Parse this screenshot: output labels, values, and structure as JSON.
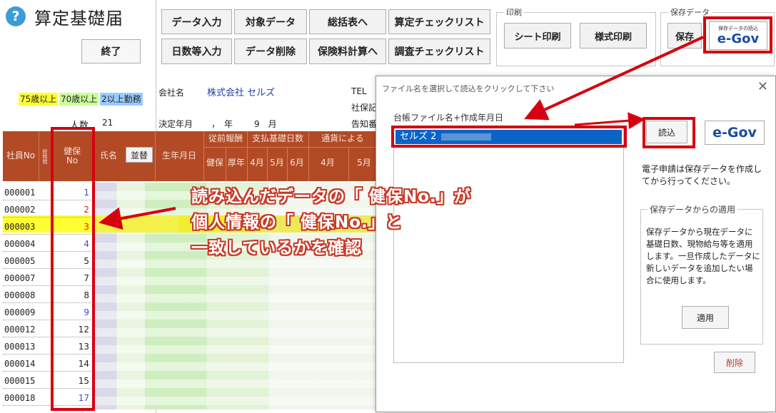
{
  "app": {
    "help_icon": "?",
    "title": "算定基礎届",
    "end_button": "終了"
  },
  "toolbar": {
    "row1": [
      "データ入力",
      "対象データ",
      "総括表へ",
      "算定チェックリスト"
    ],
    "row2": [
      "日数等入力",
      "データ削除",
      "保険料計算へ",
      "調査チェックリスト"
    ]
  },
  "print_group": {
    "label": "印刷",
    "sheet_print": "シート印刷",
    "form_print": "様式印刷"
  },
  "save_group": {
    "label": "保存データ",
    "save_button": "保存",
    "egov_caption": "保存データの読込",
    "egov_logo": "e-Gov"
  },
  "legend": {
    "age75": "75歳以上",
    "age70": "70歳以上",
    "multi": "2以上勤務",
    "count_label": "人数",
    "count_value": "21",
    "colors": {
      "age75": "#ffff33",
      "age70": "#ccff99",
      "multi": "#99ccff"
    }
  },
  "company": {
    "name_label": "会社名",
    "name_value": "株式会社 セルズ",
    "tel_label": "TEL",
    "insurance_label": "社保記",
    "decision_label": "決定年月",
    "decision_year": "，　年",
    "decision_month": "9　月",
    "notice_label": "告知番"
  },
  "table": {
    "headers": {
      "emp_no": "社員No",
      "short_time": "短時間",
      "health_no": "健保\nNo",
      "name": "氏名",
      "sort_button": "並替",
      "birth": "生年月日",
      "prev_salary": "従前報酬",
      "prev_health": "健保",
      "prev_pension": "厚年",
      "base_days": "支払基礎日数",
      "m4": "4月",
      "m5": "5月",
      "m6": "6月",
      "currency": "通貨による",
      "c4": "4月",
      "c5": "5月"
    },
    "rows": [
      {
        "id": "000001",
        "no": "1"
      },
      {
        "id": "000002",
        "no": "2"
      },
      {
        "id": "000003",
        "no": "3"
      },
      {
        "id": "000004",
        "no": "4"
      },
      {
        "id": "000005",
        "no": "5"
      },
      {
        "id": "000007",
        "no": "7"
      },
      {
        "id": "000008",
        "no": "8"
      },
      {
        "id": "000009",
        "no": "9"
      },
      {
        "id": "000012",
        "no": "12"
      },
      {
        "id": "000013",
        "no": "13"
      },
      {
        "id": "000014",
        "no": "14"
      },
      {
        "id": "000015",
        "no": "15"
      },
      {
        "id": "000018",
        "no": "17"
      }
    ]
  },
  "dialog": {
    "title": "ファイル名を選択して読込をクリックして下さい",
    "close": "✕",
    "list_label": "台帳ファイル名+作成年月日",
    "selected_item": "セルズ 2",
    "load_button": "読込",
    "egov_logo": "e-Gov",
    "info_text": "電子申請は保存データを作成してから行ってください。",
    "apply_group_label": "保存データからの適用",
    "apply_text": "保存データから現在データに基礎日数、現物給与等を適用します。一旦作成したデータに新しいデータを追加したい場合に使用します。",
    "apply_button": "適用",
    "delete_button": "削除"
  },
  "annotation": {
    "line1": "読み込んだデータの「 健保No.」が",
    "line2": "個人情報の「 健保No.」と",
    "line3": "一致しているかを確認",
    "color": "#d7000f"
  }
}
